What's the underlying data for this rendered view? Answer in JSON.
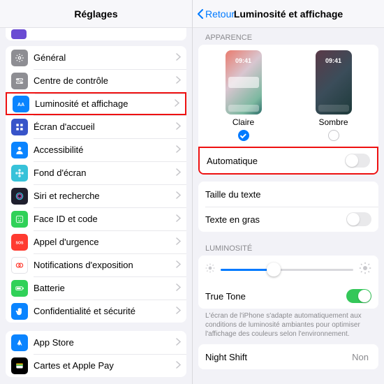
{
  "left": {
    "title": "Réglages",
    "items": [
      {
        "label": "Général",
        "iconBg": "#8e8e93",
        "icon": "gear"
      },
      {
        "label": "Centre de contrôle",
        "iconBg": "#8e8e93",
        "icon": "switches"
      },
      {
        "label": "Luminosité et affichage",
        "iconBg": "#0a84ff",
        "icon": "text-aa",
        "highlight": true
      },
      {
        "label": "Écran d'accueil",
        "iconBg": "#3854c9",
        "icon": "grid"
      },
      {
        "label": "Accessibilité",
        "iconBg": "#0a84ff",
        "icon": "person"
      },
      {
        "label": "Fond d'écran",
        "iconBg": "#37c2d9",
        "icon": "flower"
      },
      {
        "label": "Siri et recherche",
        "iconBg": "#1f1f2e",
        "icon": "siri"
      },
      {
        "label": "Face ID et code",
        "iconBg": "#30d158",
        "icon": "face"
      },
      {
        "label": "Appel d'urgence",
        "iconBg": "#ff3b30",
        "icon": "sos"
      },
      {
        "label": "Notifications d'exposition",
        "iconBg": "#ffffff",
        "icon": "exposure",
        "iconFg": "#ff3b30"
      },
      {
        "label": "Batterie",
        "iconBg": "#30d158",
        "icon": "battery"
      },
      {
        "label": "Confidentialité et sécurité",
        "iconBg": "#0a84ff",
        "icon": "hand"
      }
    ],
    "items2": [
      {
        "label": "App Store",
        "iconBg": "#0a84ff",
        "icon": "appstore"
      },
      {
        "label": "Cartes et Apple Pay",
        "iconBg": "#000000",
        "icon": "wallet"
      }
    ]
  },
  "right": {
    "back": "Retour",
    "title": "Luminosité et affichage",
    "sections": {
      "appearance": {
        "header": "Apparence",
        "thumbTime": "09:41",
        "light": "Claire",
        "dark": "Sombre",
        "selected": "light",
        "automatic": "Automatique",
        "automaticOn": false
      },
      "text": {
        "textSize": "Taille du texte",
        "bold": "Texte en gras",
        "boldOn": false
      },
      "brightness": {
        "header": "Luminosité",
        "sliderValue": 0.4,
        "trueTone": "True Tone",
        "trueToneOn": true,
        "note": "L'écran de l'iPhone s'adapte automatiquement aux conditions de luminosité ambiantes pour optimiser l'affichage des couleurs selon l'environnement."
      },
      "nightShift": {
        "label": "Night Shift",
        "value": "Non"
      }
    }
  }
}
